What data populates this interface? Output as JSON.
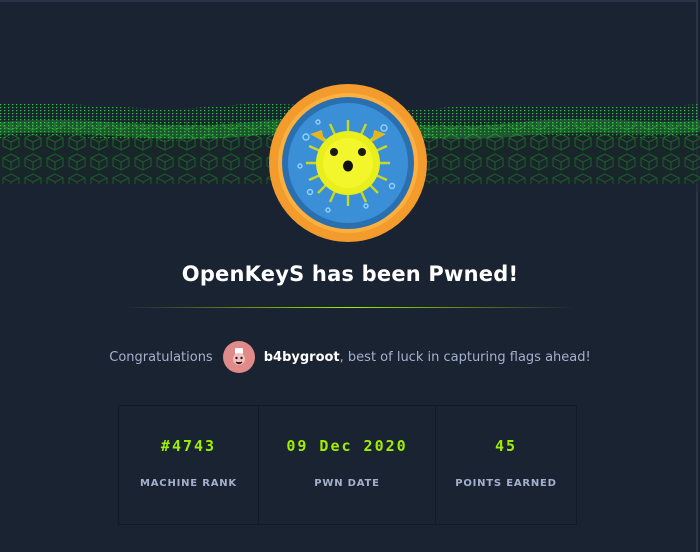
{
  "title": "OpenKeyS has been Pwned!",
  "congrats": {
    "prefix": "Congratulations",
    "username": "b4bygroot",
    "suffix": ", best of luck in capturing flags ahead!"
  },
  "stats": [
    {
      "value": "#4743",
      "label": "MACHINE RANK"
    },
    {
      "value": "09 Dec 2020",
      "label": "PWN DATE"
    },
    {
      "value": "45",
      "label": "POINTS EARNED"
    }
  ],
  "colors": {
    "background": "#1a2332",
    "accent": "#9fef00",
    "muted_text": "#a4b1cd",
    "badge_ring": "#f39b2d",
    "avatar": "#e08a8a"
  },
  "icons": {
    "badge": "pufferfish-machine-badge",
    "banner": "green-cube-grid-banner",
    "avatar": "user-avatar-icon"
  }
}
